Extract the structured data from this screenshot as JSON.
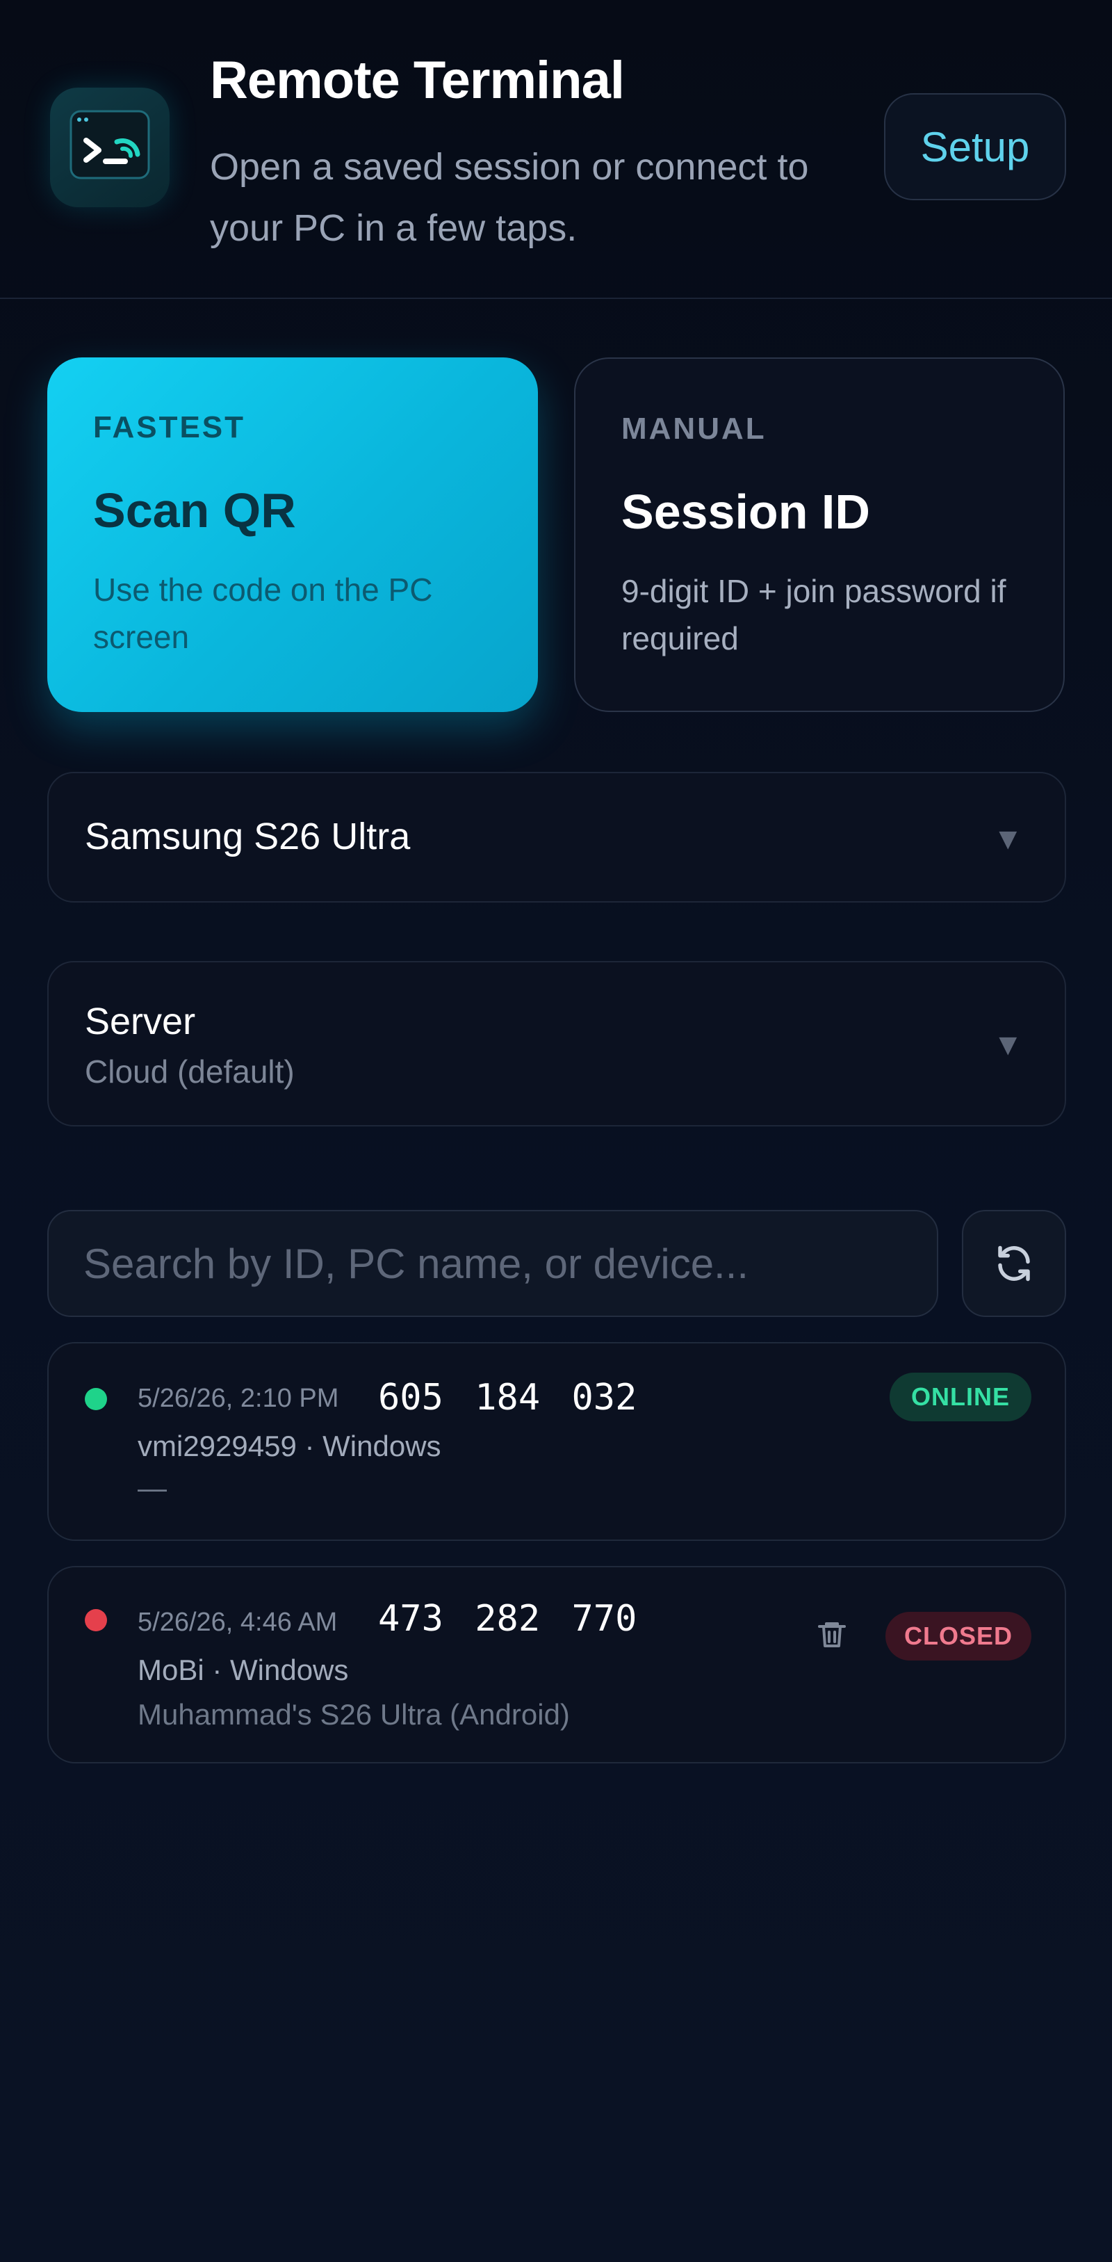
{
  "header": {
    "title": "Remote Terminal",
    "subtitle": "Open a saved session or connect to your PC in a few taps.",
    "setup_label": "Setup",
    "app_icon": "terminal-prompt-icon"
  },
  "connect": {
    "qr": {
      "kicker": "FASTEST",
      "title": "Scan QR",
      "description": "Use the code on the PC screen"
    },
    "session": {
      "kicker": "MANUAL",
      "title": "Session ID",
      "description": "9-digit ID + join password if required"
    }
  },
  "device_select": {
    "value": "Samsung S26 Ultra",
    "caret": "▼"
  },
  "server_select": {
    "label": "Server",
    "value": "Cloud (default)",
    "caret": "▼"
  },
  "search": {
    "placeholder": "Search by ID, PC name, or device...",
    "refresh_icon": "refresh-icon"
  },
  "sessions": [
    {
      "timestamp": "5/26/26, 2:10 PM",
      "id": "605 184 032",
      "host": "vmi2929459 · Windows",
      "device": "—",
      "status": "ONLINE",
      "status_color": "#1fd38a"
    },
    {
      "timestamp": "5/26/26, 4:46 AM",
      "id": "473 282 770",
      "host": "MoBi · Windows",
      "device": "Muhammad's S26 Ultra (Android)",
      "status": "CLOSED",
      "status_color": "#e5404c"
    }
  ],
  "colors": {
    "accent": "#14d0f2",
    "background": "#070d1a",
    "online": "#35e0a4",
    "closed": "#f07a8e"
  }
}
